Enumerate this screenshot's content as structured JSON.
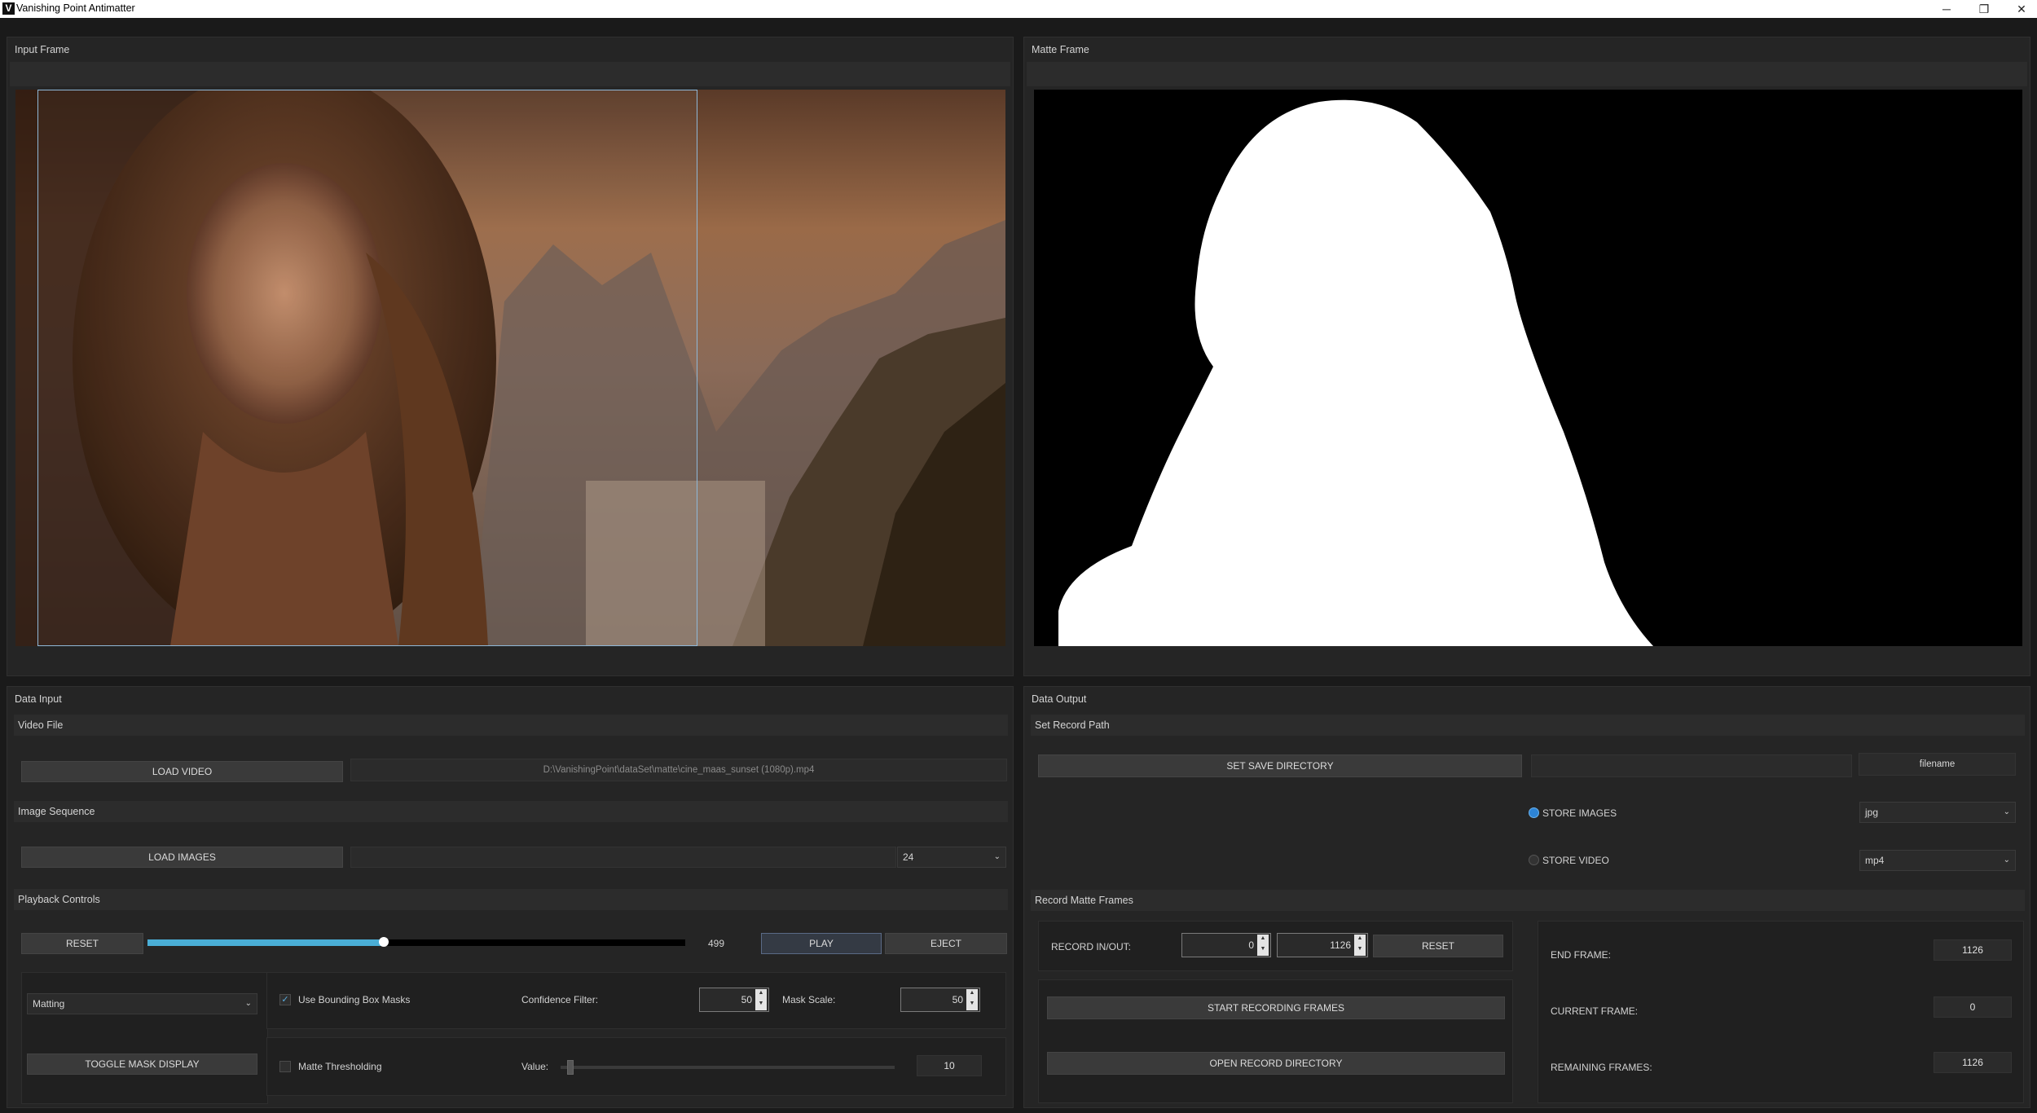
{
  "window": {
    "title": "Vanishing Point Antimatter",
    "logo": "V",
    "minimize": "─",
    "restore": "❐",
    "close": "✕"
  },
  "input_frame": {
    "title": "Input Frame"
  },
  "matte_frame": {
    "title": "Matte Frame"
  },
  "data_input": {
    "title": "Data Input",
    "video_file": {
      "header": "Video File",
      "load_label": "LOAD VIDEO",
      "path": "D:\\VanishingPoint\\dataSet\\matte\\cine_maas_sunset (1080p).mp4"
    },
    "image_sequence": {
      "header": "Image Sequence",
      "load_label": "LOAD IMAGES",
      "path": "",
      "fps": "24"
    },
    "playback": {
      "header": "Playback Controls",
      "reset_label": "RESET",
      "frame": "499",
      "progress": 0.44,
      "play_label": "PLAY",
      "eject_label": "EJECT"
    },
    "mode": {
      "selected": "Matting",
      "toggle_label": "TOGGLE MASK DISPLAY"
    },
    "bbox": {
      "checked": true,
      "label": "Use Bounding Box Masks",
      "confidence_label": "Confidence Filter:",
      "confidence": "50",
      "mask_scale_label": "Mask Scale:",
      "mask_scale": "50"
    },
    "threshold": {
      "checked": false,
      "label": "Matte Thresholding",
      "value_label": "Value:",
      "value": "10",
      "slider_fraction": 0.02
    }
  },
  "data_output": {
    "title": "Data Output",
    "record_path": {
      "header": "Set Record Path",
      "save_dir_label": "SET SAVE DIRECTORY",
      "directory": "",
      "filename": "filename",
      "store_images_label": "STORE IMAGES",
      "store_images_selected": true,
      "image_format": "jpg",
      "store_video_label": "STORE VIDEO",
      "store_video_selected": false,
      "video_format": "mp4"
    },
    "record": {
      "header": "Record Matte Frames",
      "in_out_label": "RECORD IN/OUT:",
      "in": "0",
      "out": "1126",
      "reset_label": "RESET",
      "start_label": "START RECORDING FRAMES",
      "open_dir_label": "OPEN RECORD DIRECTORY",
      "end_frame_label": "END FRAME:",
      "end_frame": "1126",
      "current_frame_label": "CURRENT FRAME:",
      "current_frame": "0",
      "remaining_label": "REMAINING FRAMES:",
      "remaining": "1126"
    }
  }
}
